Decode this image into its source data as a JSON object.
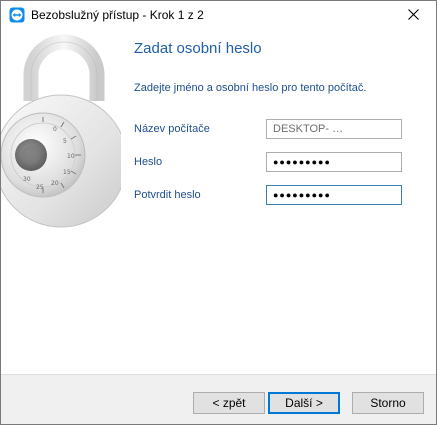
{
  "window": {
    "title": "Bezobslužný přístup - Krok 1 z 2"
  },
  "page": {
    "heading": "Zadat osobní heslo",
    "description": "Zadejte jméno a osobní heslo pro tento počítač."
  },
  "form": {
    "computer_name": {
      "label": "Název počítače",
      "value": "DESKTOP-  …"
    },
    "password": {
      "label": "Heslo",
      "value": "●●●●●●●●●"
    },
    "confirm_password": {
      "label": "Potvrdit heslo",
      "value": "●●●●●●●●●"
    }
  },
  "buttons": {
    "back": "< zpět",
    "next": "Další >",
    "cancel": "Storno"
  },
  "icons": {
    "app": "teamviewer-icon",
    "close": "close-icon",
    "illustration": "combination-padlock"
  },
  "colors": {
    "heading": "#1f5fa8",
    "label": "#1f4f8f",
    "default_button_border": "#0078d7",
    "focused_field_border": "#3c7fb1"
  }
}
